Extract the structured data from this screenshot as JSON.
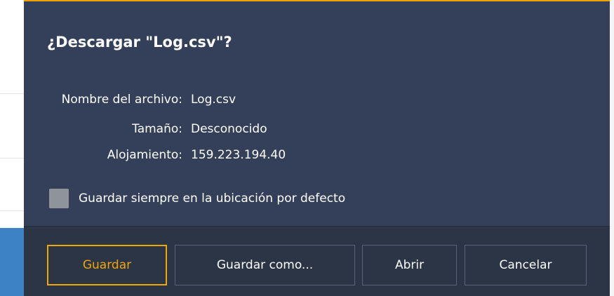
{
  "dialog": {
    "title": "¿Descargar \"Log.csv\"?",
    "file_name_label": "Nombre del archivo:",
    "file_name_value": "Log.csv",
    "size_label": "Tamaño:",
    "size_value": "Desconocido",
    "host_label": "Alojamiento:",
    "host_value": "159.223.194.40",
    "always_save_label": "Guardar siempre en la ubicación por defecto",
    "always_save_checked": false
  },
  "buttons": {
    "save": "Guardar",
    "save_as": "Guardar como...",
    "open": "Abrir",
    "cancel": "Cancelar"
  },
  "colors": {
    "dialog_background": "#34405a",
    "footer_background": "#2b3546",
    "accent": "#f2a600"
  }
}
